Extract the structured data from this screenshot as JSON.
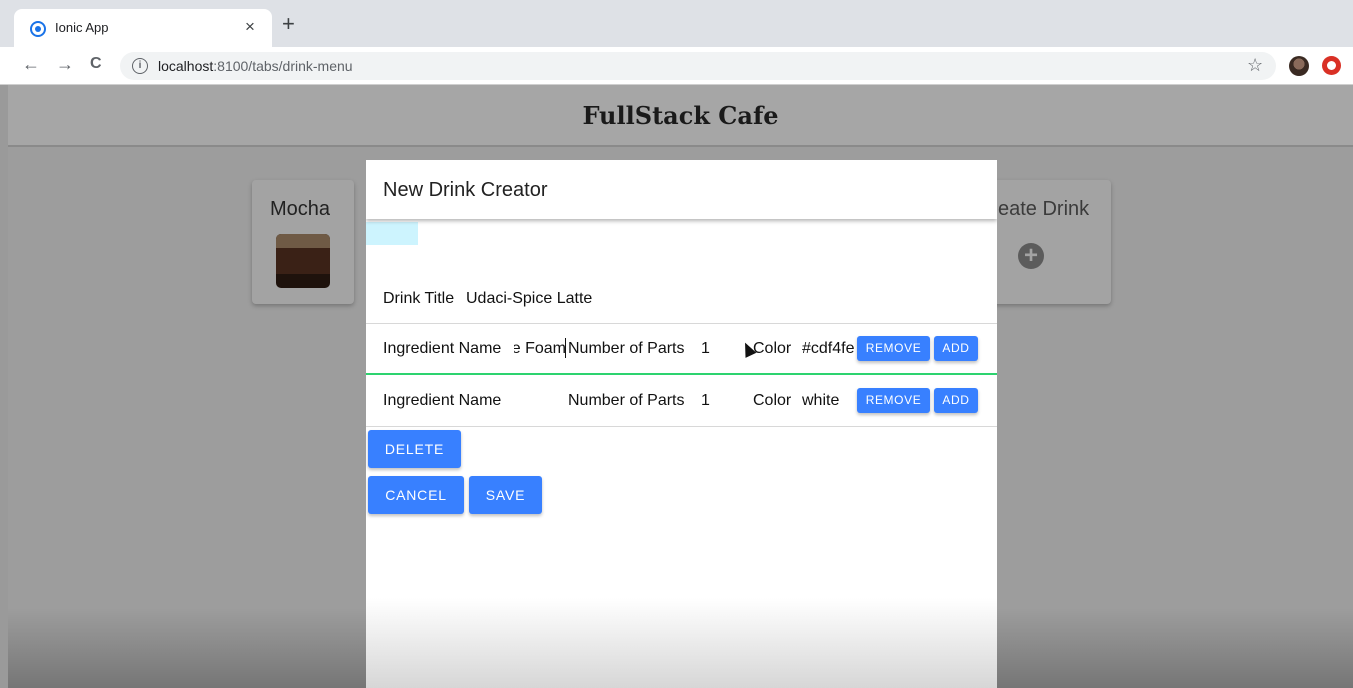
{
  "browser": {
    "tab_title": "Ionic App",
    "tab_close": "×",
    "new_tab": "+",
    "back": "←",
    "forward": "→",
    "reload": "C",
    "info": "i",
    "url_host": "localhost",
    "url_path": ":8100/tabs/drink-menu",
    "star": "☆"
  },
  "app": {
    "title": "FullStack Cafe",
    "cards": [
      {
        "title": "Mocha"
      },
      {
        "title": "eate Drink",
        "icon": "plus-icon"
      }
    ]
  },
  "modal": {
    "title": "New Drink Creator",
    "preview_color": "#cdf4fe",
    "drink_title_label": "Drink Title",
    "drink_title_value": "Udaci-Spice Latte",
    "ingredients": [
      {
        "name_label": "Ingredient Name",
        "name_value": "e Foam",
        "parts_label": "Number of Parts",
        "parts_value": "1",
        "color_label": "Color",
        "color_value": "#cdf4fe",
        "remove_label": "REMOVE",
        "add_label": "ADD"
      },
      {
        "name_label": "Ingredient Name",
        "name_value": "",
        "parts_label": "Number of Parts",
        "parts_value": "1",
        "color_label": "Color",
        "color_value": "white",
        "remove_label": "REMOVE",
        "add_label": "ADD"
      }
    ],
    "delete_label": "DELETE",
    "cancel_label": "CANCEL",
    "save_label": "SAVE"
  },
  "colors": {
    "accent": "#3880ff",
    "focus_underline": "#2dd36f"
  }
}
